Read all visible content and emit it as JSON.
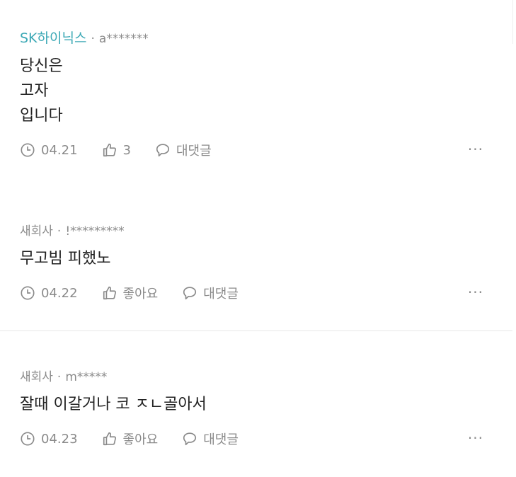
{
  "comments": [
    {
      "company": "SK하이닉스",
      "separator": "·",
      "user": "a*******",
      "lines": [
        "당신은",
        "고자",
        "입니다"
      ],
      "date": "04.21",
      "likes": "3",
      "reply_label": "대댓글",
      "more_label": "···"
    },
    {
      "company": "새회사",
      "separator": "·",
      "user": "!*********",
      "lines": [
        "무고빔 피했노"
      ],
      "date": "04.22",
      "likes": "좋아요",
      "reply_label": "대댓글",
      "more_label": "···"
    },
    {
      "company": "새회사",
      "separator": "·",
      "user": "m*****",
      "lines": [
        "잘때 이갈거나 코 ㅈㄴ골아서"
      ],
      "date": "04.23",
      "likes": "좋아요",
      "reply_label": "대댓글",
      "more_label": "···"
    }
  ],
  "colors": {
    "brand_company": "#3ba8b5",
    "meta_text": "#8a8a8a",
    "body_text": "#222222",
    "divider": "#e6e6e6"
  },
  "icons": {
    "time": "clock-icon",
    "like": "thumbs-up-icon",
    "reply": "speech-bubble-icon",
    "more": "more-dots-icon"
  }
}
